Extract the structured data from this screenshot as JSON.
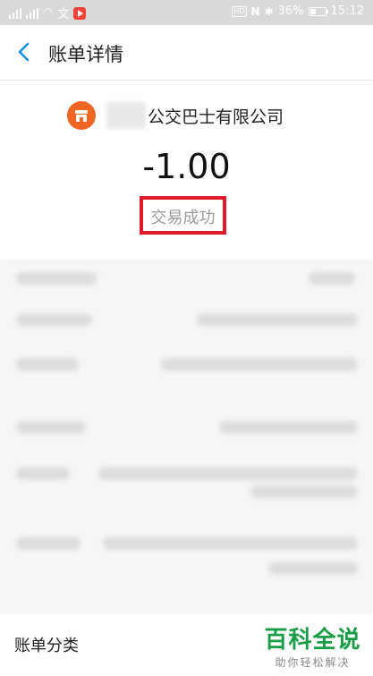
{
  "status_bar": {
    "network_1": "2G",
    "network_2": "4G",
    "app_label": "文",
    "hd": "HD",
    "nfc": "N",
    "bluetooth": "✱",
    "battery": "36%",
    "battery_level": 0.36,
    "time": "15:12"
  },
  "header": {
    "title": "账单详情"
  },
  "merchant": {
    "name": "公交巴士有限公司",
    "logo_color": "#ef6524"
  },
  "transaction": {
    "amount": "-1.00",
    "status": "交易成功",
    "highlight_color": "#e0192b"
  },
  "bottom": {
    "category_label": "账单分类"
  },
  "watermark": {
    "title": "百科全说",
    "subtitle": "助你轻松解决"
  }
}
